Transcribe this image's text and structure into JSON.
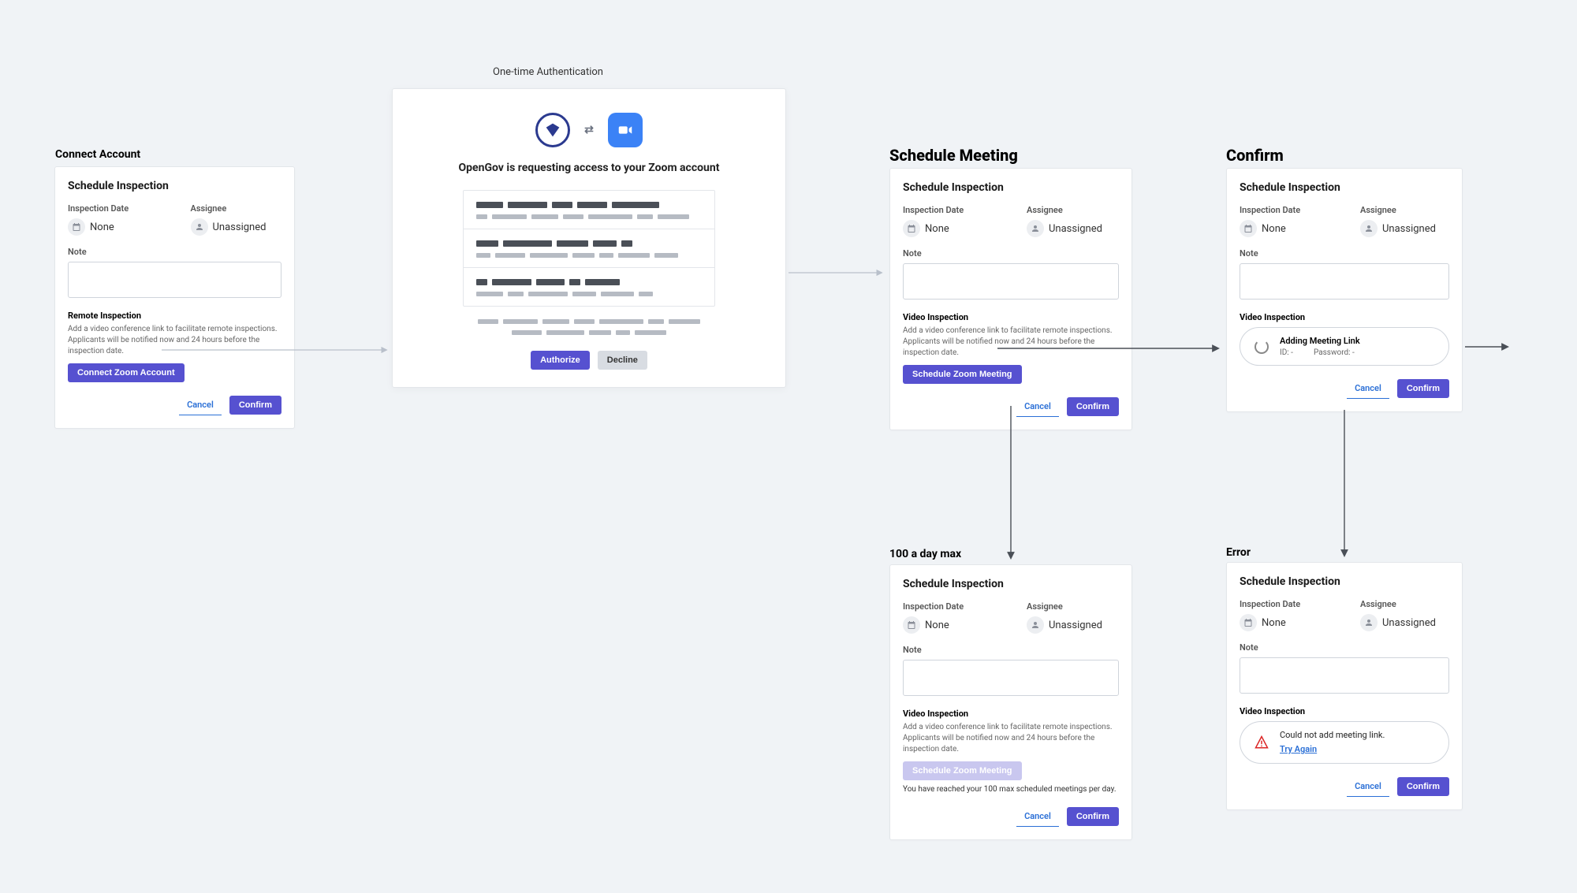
{
  "sections": {
    "connect": "Connect Account",
    "auth": "One-time Authentication",
    "schedule": "Schedule Meeting",
    "confirm": "Confirm",
    "max": "100 a day max",
    "error": "Error"
  },
  "card": {
    "header": "Schedule Inspection",
    "inspection_date_label": "Inspection Date",
    "inspection_date_value": "None",
    "assignee_label": "Assignee",
    "assignee_value": "Unassigned",
    "note_label": "Note",
    "remote_header": "Remote Inspection",
    "video_header": "Video Inspection",
    "remote_desc": "Add a video conference link to facilitate remote inspections. Applicants will be notified now and 24 hours before the inspection date.",
    "connect_btn": "Connect Zoom Account",
    "schedule_btn": "Schedule Zoom Meeting",
    "max_notice": "You have reached your 100 max scheduled meetings per day.",
    "cancel": "Cancel",
    "confirm": "Confirm"
  },
  "auth": {
    "heading": "OpenGov is requesting access to your Zoom account",
    "authorize": "Authorize",
    "decline": "Decline"
  },
  "loading": {
    "title": "Adding Meeting Link",
    "id_label": "ID: -",
    "pw_label": "Password: -"
  },
  "error_pill": {
    "text": "Could not add meeting link.",
    "retry": "Try Again"
  }
}
